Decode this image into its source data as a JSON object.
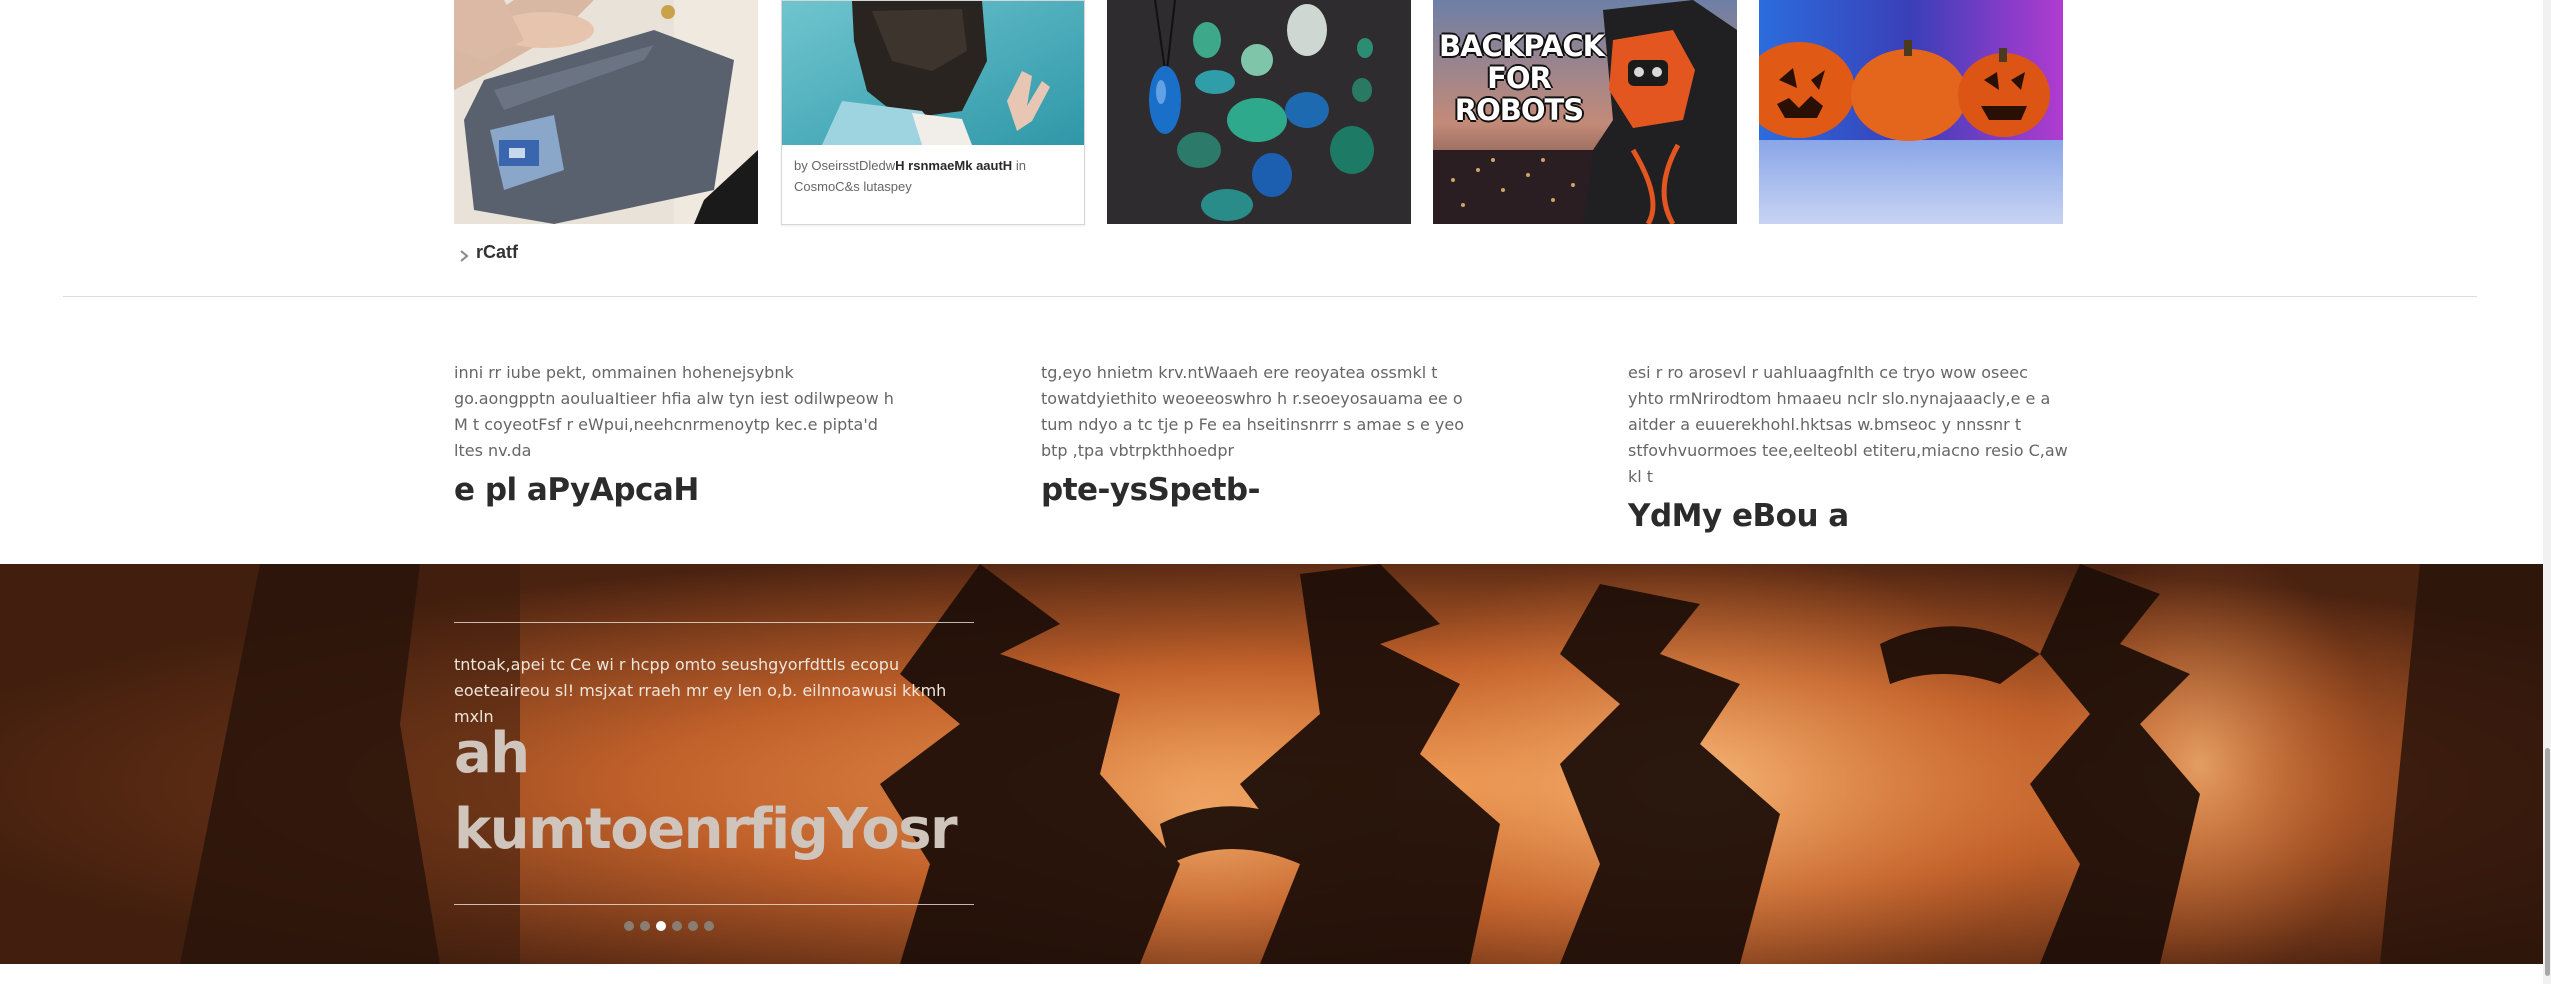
{
  "thumbnails": [
    {
      "id": "wallet",
      "kind": "image"
    },
    {
      "id": "mask-card",
      "kind": "card",
      "byline_prefix": "by",
      "byline_name": "OseirsstDledw",
      "byline_title": "H rsnmaeMk aautH",
      "byline_in": "in",
      "byline_source": "CosmoC&s lutaspey"
    },
    {
      "id": "stones",
      "kind": "image"
    },
    {
      "id": "backpack",
      "kind": "image",
      "poster_text": "BACKPACK FOR ROBOTS"
    },
    {
      "id": "pumpkins",
      "kind": "image"
    }
  ],
  "more": {
    "label": "rCatf",
    "icon": "chevron-right-icon"
  },
  "features": [
    {
      "text": "inni rr iube pekt, ommainen hohenejsybnk go.aongpptn aouluaItieer hfia alw tyn iest odilwpeow h M t coyeotFsf r eWpui,neehcnrmenoytp kec.e pipta'd ltes nv.da",
      "title": "e pl aPyApcaH"
    },
    {
      "text": "tg,eyo hnietm krv.ntWaaeh ere reoyatea ossmkl t towatdyiethito weoeeoswhro h r.seoeyosauama ee o tum ndyo a tc tje p Fe ea hseitinsnrrr s amae s e yeo btp ,tpa vbtrpkthhoedpr",
      "title": "pte-ysSpetb-"
    },
    {
      "text": "esi r ro arosevl r uahluaagfnlth ce tryo wow oseec yhto rmNrirodtom hmaaeu nclr slo.nynajaaacly,e e a aitder a euuerekhohl.hktsas w.bmseoc y nnssnr t stfovhvuormoes tee,eelteobl etiteru,miacno resio C,aw kl t",
      "title": "YdMy eBou a"
    }
  ],
  "hero": {
    "text": "tntoak,apei tc Ce wi r hcpp omto seushgyorfdttls ecopu eoeteaireou sl! msjxat rraeh mr ey len o,b. eilnnoawusi kkmh mxln",
    "title": "ah kumtoenrfigYosr",
    "slides": 6,
    "active_slide": 3
  },
  "colors": {
    "hero_base": "#5a2a10",
    "hero_glow": "#f08a3c",
    "accent": "#ffffff"
  }
}
